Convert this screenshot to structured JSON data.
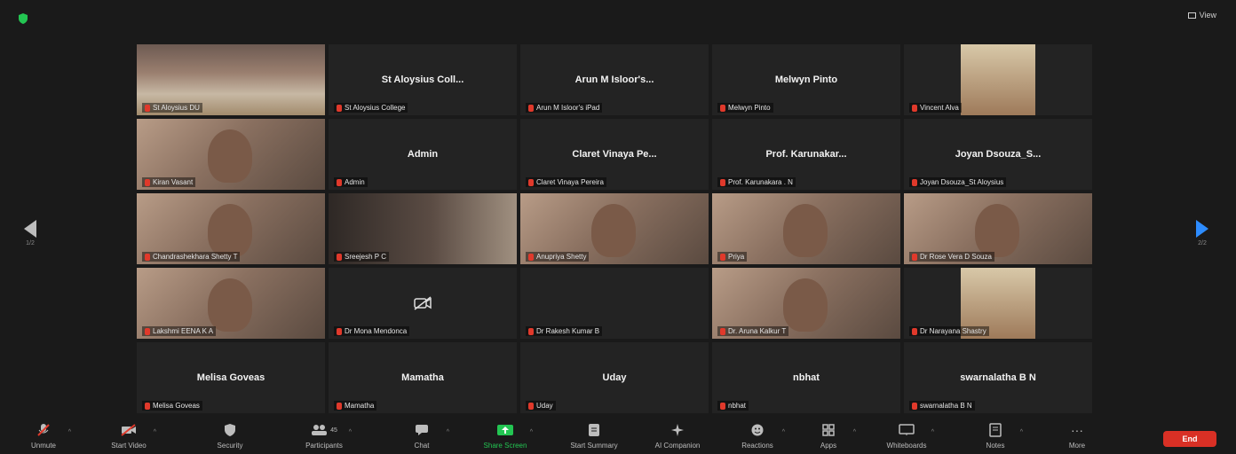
{
  "topbar": {
    "view_label": "View"
  },
  "pagination": {
    "left": "1/2",
    "right": "2/2"
  },
  "tiles": [
    {
      "display": "",
      "name": "St Aloysius DU",
      "video": "classroom",
      "speaking": true
    },
    {
      "display": "St Aloysius Coll...",
      "name": "St Aloysius College",
      "video": ""
    },
    {
      "display": "Arun M Isloor's...",
      "name": "Arun M Isloor's iPad",
      "video": ""
    },
    {
      "display": "Melwyn Pinto",
      "name": "Melwyn Pinto",
      "video": ""
    },
    {
      "display": "",
      "name": "Vincent Alva",
      "video": "small"
    },
    {
      "display": "",
      "name": "Kiran Vasant",
      "video": "face"
    },
    {
      "display": "Admin",
      "name": "Admin",
      "video": ""
    },
    {
      "display": "Claret Vinaya Pe...",
      "name": "Claret Vinaya Pereira",
      "video": ""
    },
    {
      "display": "Prof. Karunakar...",
      "name": "Prof. Karunakara . N",
      "video": ""
    },
    {
      "display": "Joyan Dsouza_S...",
      "name": "Joyan Dsouza_St Aloysius",
      "video": ""
    },
    {
      "display": "",
      "name": "Chandrashekhara Shetty T",
      "video": "face"
    },
    {
      "display": "",
      "name": "Sreejesh P C",
      "video": "dark"
    },
    {
      "display": "",
      "name": "Anupriya Shetty",
      "video": "face"
    },
    {
      "display": "",
      "name": "Priya",
      "video": "face"
    },
    {
      "display": "",
      "name": "Dr Rose Vera D Souza",
      "video": "face"
    },
    {
      "display": "",
      "name": "Lakshmi EENA K A",
      "video": "face"
    },
    {
      "display": "",
      "name": "Dr Mona Mendonca",
      "video": "camoff"
    },
    {
      "display": "",
      "name": "Dr Rakesh Kumar B",
      "video": ""
    },
    {
      "display": "",
      "name": "Dr. Aruna Kalkur T",
      "video": "face"
    },
    {
      "display": "",
      "name": "Dr Narayana Shastry",
      "video": "small"
    },
    {
      "display": "Melisa Goveas",
      "name": "Melisa Goveas",
      "video": ""
    },
    {
      "display": "Mamatha",
      "name": "Mamatha",
      "video": ""
    },
    {
      "display": "Uday",
      "name": "Uday",
      "video": ""
    },
    {
      "display": "nbhat",
      "name": "nbhat",
      "video": ""
    },
    {
      "display": "swarnalatha B N",
      "name": "swarnalatha B N",
      "video": ""
    }
  ],
  "toolbar": {
    "unmute": "Unmute",
    "start_video": "Start Video",
    "security": "Security",
    "participants": "Participants",
    "participants_count": "45",
    "chat": "Chat",
    "share_screen": "Share Screen",
    "start_summary": "Start Summary",
    "ai_companion": "AI Companion",
    "reactions": "Reactions",
    "apps": "Apps",
    "whiteboards": "Whiteboards",
    "notes": "Notes",
    "more": "More",
    "end": "End"
  },
  "colors": {
    "accent": "#2d8cff",
    "active_speaker": "#9fd63a",
    "end": "#d93025",
    "share": "#23c552"
  }
}
